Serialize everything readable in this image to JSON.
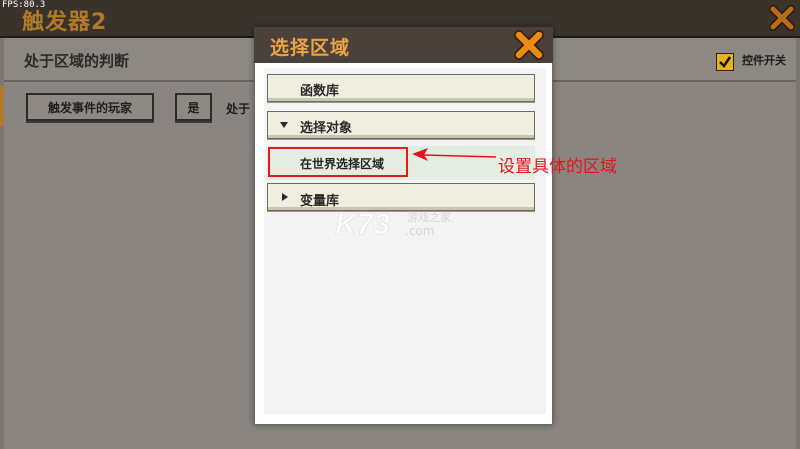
{
  "hud": {
    "fps": "FPS:80.3"
  },
  "window": {
    "title": "触发器2",
    "section_title": "处于区域的判断",
    "toggle_label": "控件开关",
    "toggle_checked": true,
    "buttons": {
      "event_player": "触发事件的玩家",
      "yes": "是"
    },
    "text_in": "处于"
  },
  "dialog": {
    "title": "选择区域",
    "categories": [
      {
        "label": "函数库",
        "expanded": null
      },
      {
        "label": "选择对象",
        "expanded": true,
        "children": [
          "在世界选择区域"
        ]
      },
      {
        "label": "变量库",
        "expanded": false
      }
    ]
  },
  "annotation": {
    "text": "设置具体的区域"
  },
  "watermark": {
    "brand": "K73",
    "text": "游戏之家",
    "domain": ".com"
  },
  "colors": {
    "accent": "#e8a445",
    "title_gold": "#b07a2a",
    "annotation_red": "#e0151a",
    "close_orange": "#ec8a16"
  }
}
